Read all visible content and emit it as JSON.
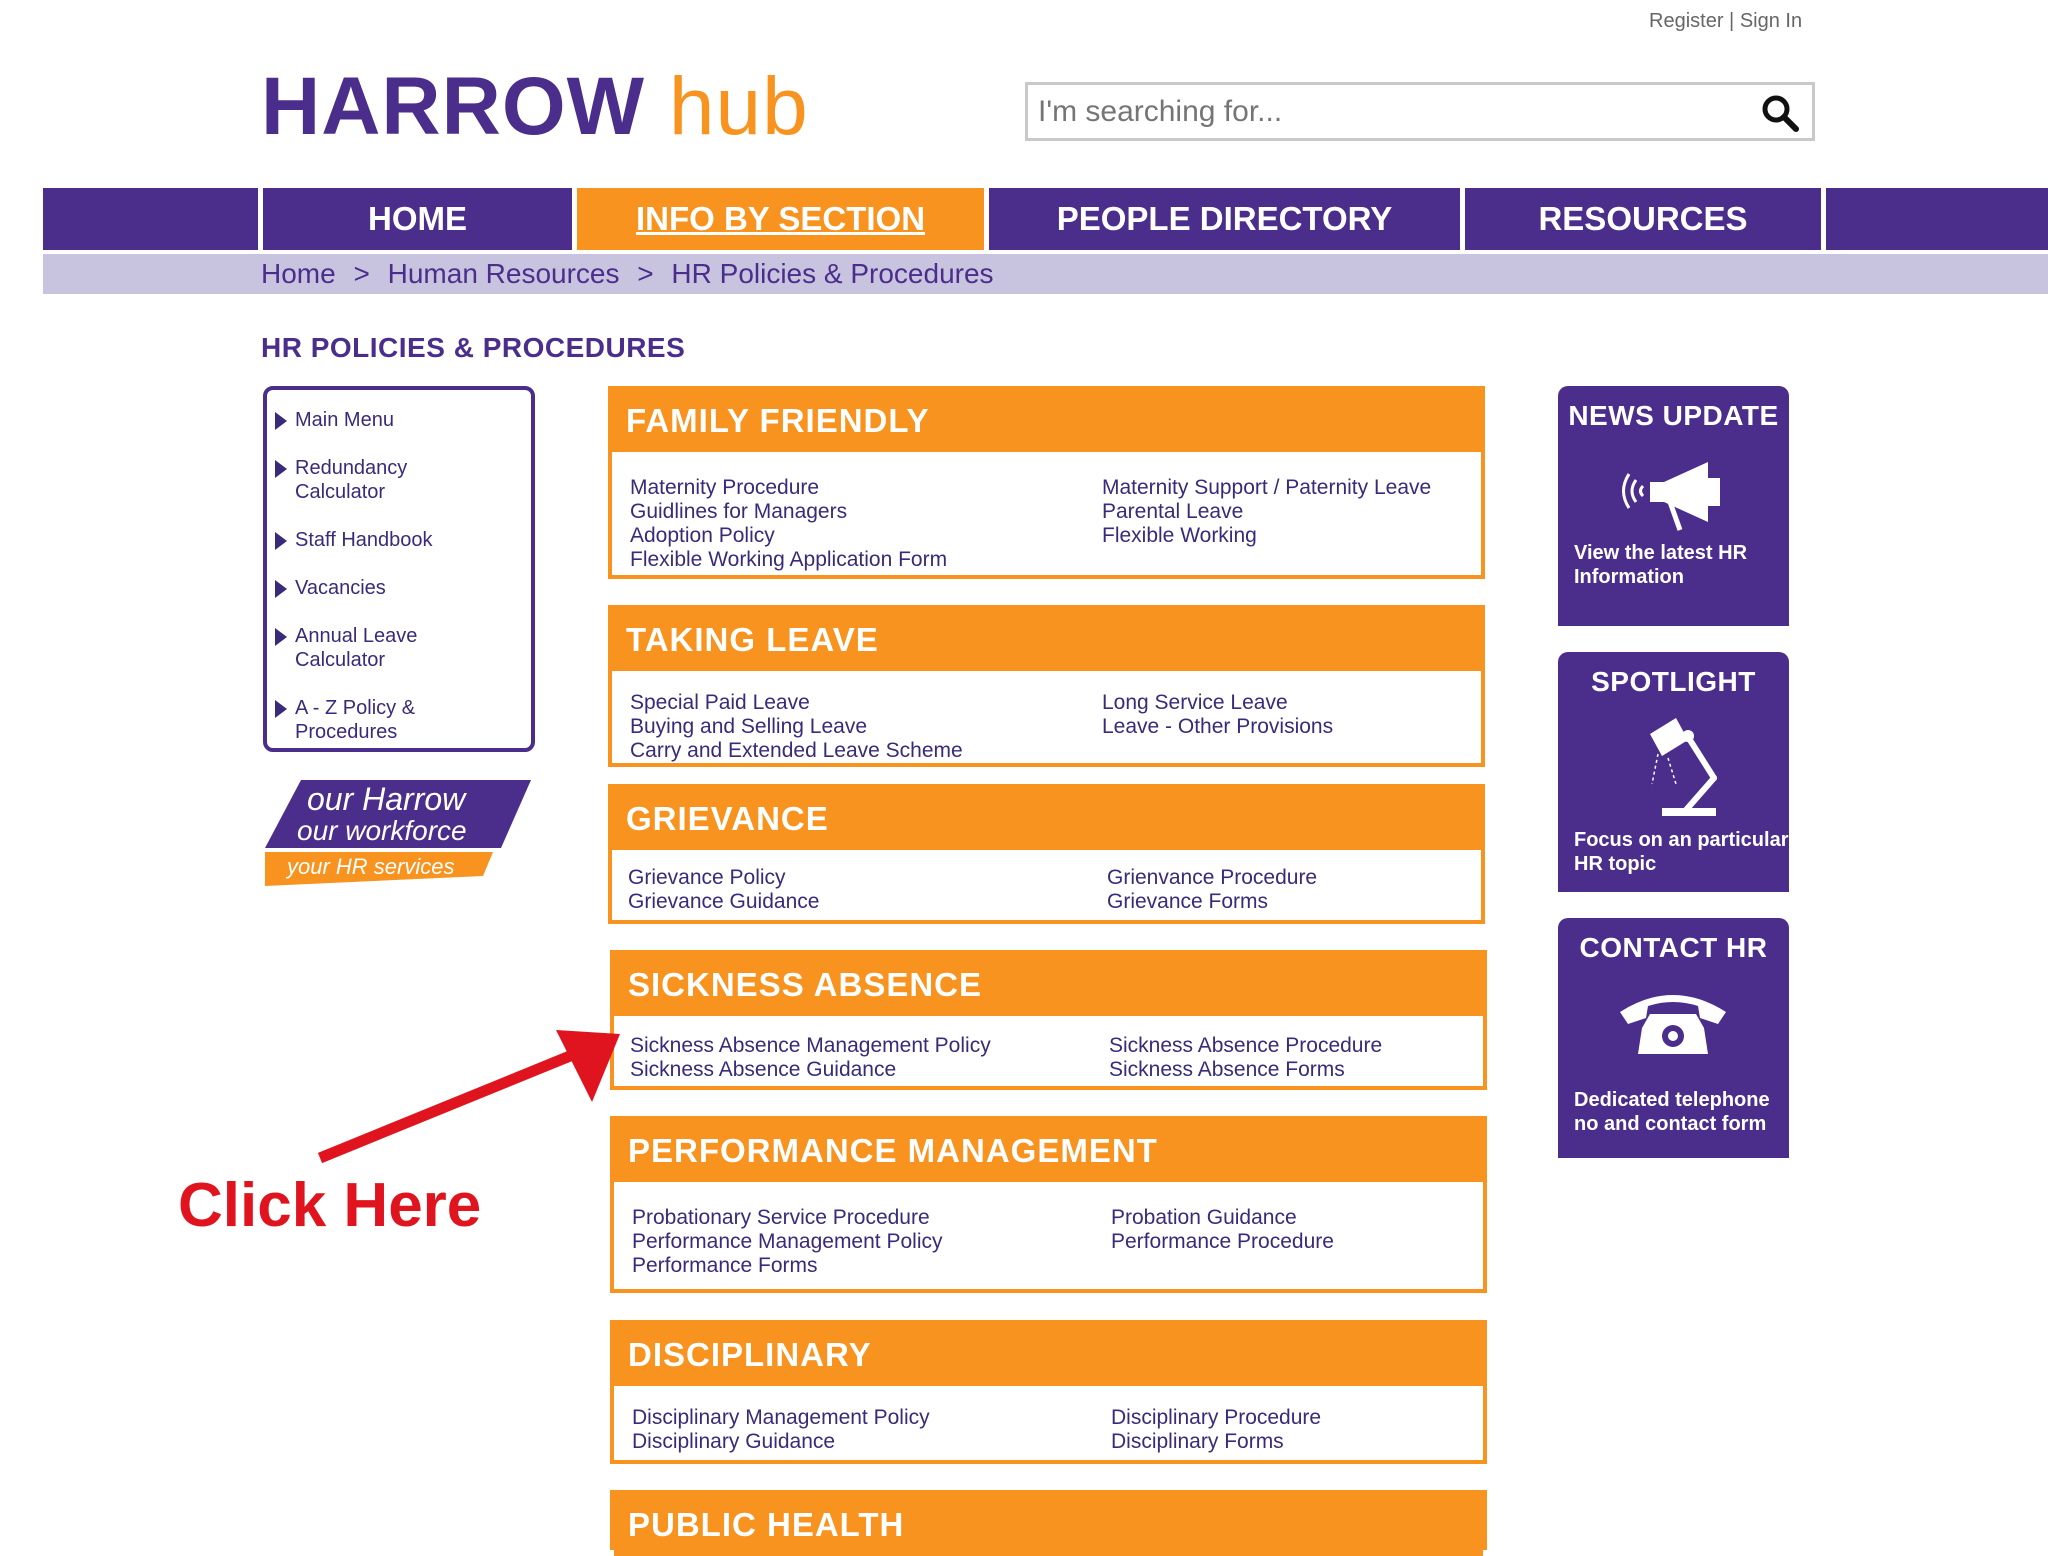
{
  "header": {
    "register": "Register",
    "separator": "|",
    "signin": "Sign In",
    "logo_part1": "HARROW",
    "logo_part2": "hub",
    "search_placeholder": "I'm searching for..."
  },
  "nav": {
    "home": "HOME",
    "info": "INFO BY SECTION",
    "people": "PEOPLE DIRECTORY",
    "resources": "RESOURCES"
  },
  "breadcrumb": {
    "home": "Home",
    "sep1": ">",
    "hr": "Human Resources",
    "sep2": ">",
    "current": "HR Policies & Procedures"
  },
  "page_title": "HR POLICIES & PROCEDURES",
  "sidebar": {
    "items": [
      "Main Menu",
      "Redundancy Calculator",
      "Staff Handbook",
      "Vacancies",
      "Annual Leave Calculator",
      "A - Z Policy & Procedures"
    ],
    "brand_line1": "our Harrow",
    "brand_line2": "our workforce",
    "brand_line3": "your HR services"
  },
  "sections": [
    {
      "title": "FAMILY FRIENDLY",
      "left": [
        "Maternity Procedure",
        "Guidlines for Managers",
        "Adoption Policy",
        "Flexible Working  Application Form"
      ],
      "right": [
        "Maternity Support / Paternity Leave",
        "Parental Leave",
        "Flexible Working"
      ]
    },
    {
      "title": "TAKING LEAVE",
      "left": [
        "Special Paid Leave",
        "Buying and Selling Leave",
        "Carry and Extended Leave Scheme"
      ],
      "right": [
        "Long Service Leave",
        "Leave - Other Provisions"
      ]
    },
    {
      "title": "GRIEVANCE",
      "left": [
        "Grievance Policy",
        "Grievance Guidance"
      ],
      "right": [
        "Grienvance Procedure",
        "Grievance Forms"
      ]
    },
    {
      "title": "SICKNESS ABSENCE",
      "left": [
        "Sickness Absence Management Policy",
        "Sickness Absence Guidance"
      ],
      "right": [
        "Sickness Absence Procedure",
        "Sickness Absence Forms"
      ]
    },
    {
      "title": "PERFORMANCE MANAGEMENT",
      "left": [
        "Probationary Service Procedure",
        "Performance Management Policy",
        "Performance Forms"
      ],
      "right": [
        "Probation Guidance",
        "Performance Procedure"
      ]
    },
    {
      "title": "DISCIPLINARY",
      "left": [
        "Disciplinary Management Policy",
        "Disciplinary Guidance"
      ],
      "right": [
        "Disciplinary Procedure",
        "Disciplinary Forms"
      ]
    },
    {
      "title": "PUBLIC HEALTH",
      "left": [],
      "right": []
    }
  ],
  "tiles": {
    "news": {
      "title": "NEWS UPDATE",
      "desc1": "View the latest HR",
      "desc2": "Information",
      "icon": "megaphone-icon"
    },
    "spotlight": {
      "title": "SPOTLIGHT",
      "desc1": "Focus on an particular",
      "desc2": "HR topic",
      "icon": "desk-lamp-icon"
    },
    "contact": {
      "title": "CONTACT HR",
      "desc1": "Dedicated telephone",
      "desc2": "no and contact form",
      "icon": "telephone-icon"
    }
  },
  "annotation": {
    "text": "Click Here",
    "color": "#e0141e"
  },
  "colors": {
    "purple": "#4b2e8c",
    "orange": "#f7931e",
    "lavender": "#c8c3df"
  }
}
